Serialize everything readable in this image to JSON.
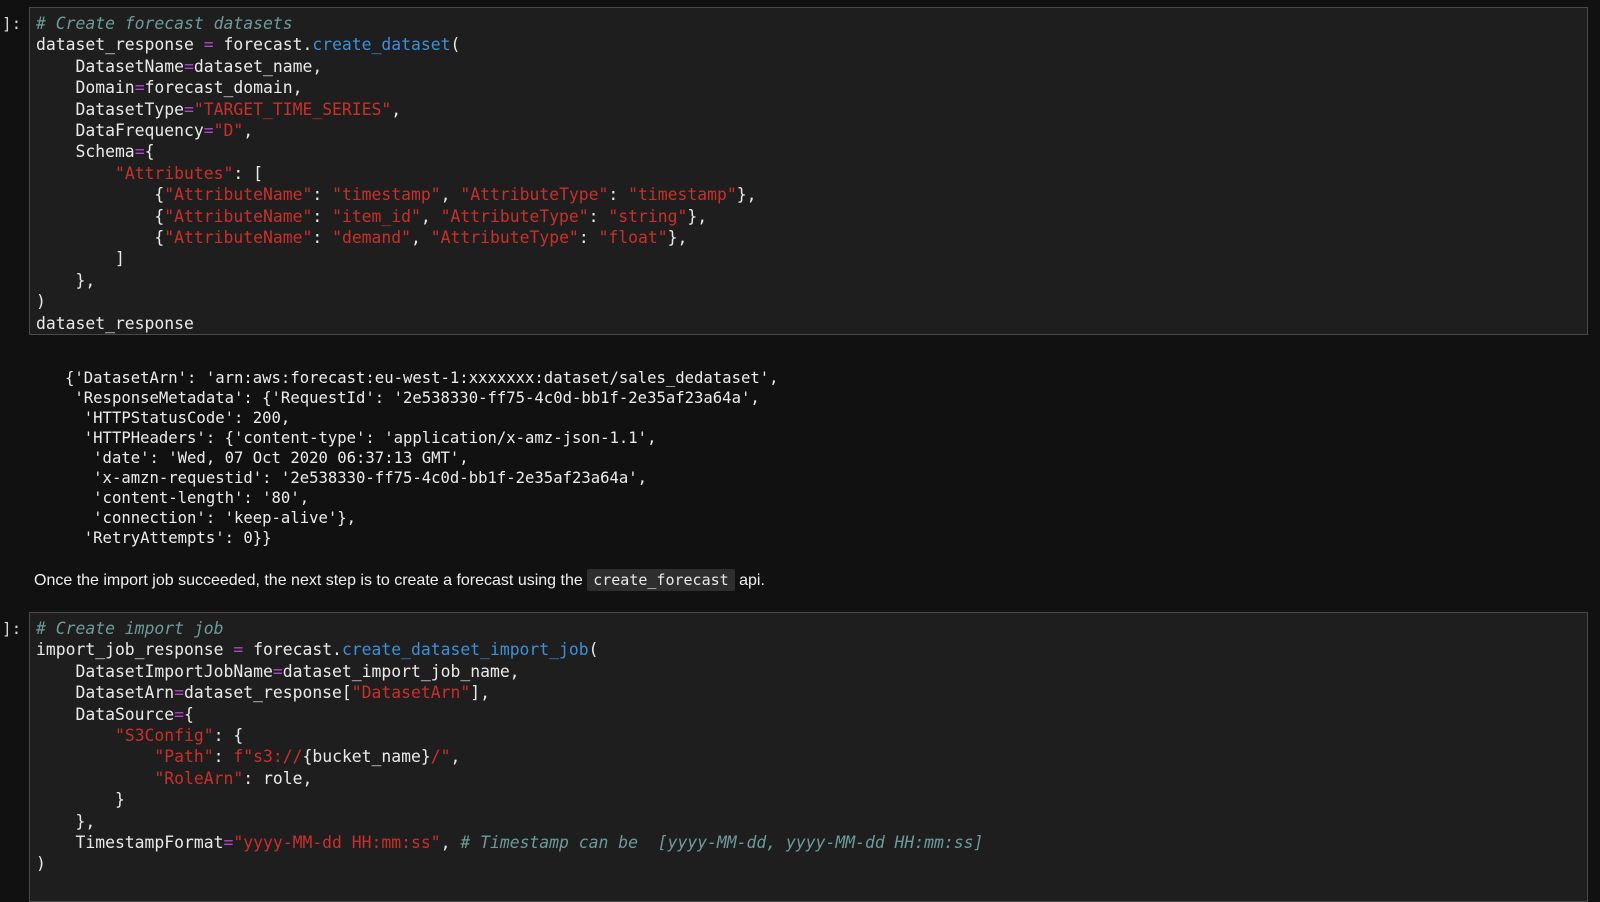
{
  "cells": [
    {
      "prompt": "]:",
      "lines": [
        [
          [
            "cm",
            "# Create forecast datasets"
          ]
        ],
        [
          [
            "t",
            "dataset_response "
          ],
          [
            "op",
            "="
          ],
          [
            "t",
            " forecast."
          ],
          [
            "fn",
            "create_dataset"
          ],
          [
            "t",
            "("
          ]
        ],
        [
          [
            "t",
            "    DatasetName"
          ],
          [
            "op",
            "="
          ],
          [
            "t",
            "dataset_name,"
          ]
        ],
        [
          [
            "t",
            "    Domain"
          ],
          [
            "op",
            "="
          ],
          [
            "t",
            "forecast_domain,"
          ]
        ],
        [
          [
            "t",
            "    DatasetType"
          ],
          [
            "op",
            "="
          ],
          [
            "st",
            "\"TARGET_TIME_SERIES\""
          ],
          [
            "t",
            ","
          ]
        ],
        [
          [
            "t",
            "    DataFrequency"
          ],
          [
            "op",
            "="
          ],
          [
            "st",
            "\"D\""
          ],
          [
            "t",
            ","
          ]
        ],
        [
          [
            "t",
            "    Schema"
          ],
          [
            "op",
            "="
          ],
          [
            "t",
            "{"
          ]
        ],
        [
          [
            "t",
            "        "
          ],
          [
            "st",
            "\"Attributes\""
          ],
          [
            "t",
            ": ["
          ]
        ],
        [
          [
            "t",
            "            {"
          ],
          [
            "st",
            "\"AttributeName\""
          ],
          [
            "t",
            ": "
          ],
          [
            "st",
            "\"timestamp\""
          ],
          [
            "t",
            ", "
          ],
          [
            "st",
            "\"AttributeType\""
          ],
          [
            "t",
            ": "
          ],
          [
            "st",
            "\"timestamp\""
          ],
          [
            "t",
            "},"
          ]
        ],
        [
          [
            "t",
            "            {"
          ],
          [
            "st",
            "\"AttributeName\""
          ],
          [
            "t",
            ": "
          ],
          [
            "st",
            "\"item_id\""
          ],
          [
            "t",
            ", "
          ],
          [
            "st",
            "\"AttributeType\""
          ],
          [
            "t",
            ": "
          ],
          [
            "st",
            "\"string\""
          ],
          [
            "t",
            "},"
          ]
        ],
        [
          [
            "t",
            "            {"
          ],
          [
            "st",
            "\"AttributeName\""
          ],
          [
            "t",
            ": "
          ],
          [
            "st",
            "\"demand\""
          ],
          [
            "t",
            ", "
          ],
          [
            "st",
            "\"AttributeType\""
          ],
          [
            "t",
            ": "
          ],
          [
            "st",
            "\"float\""
          ],
          [
            "t",
            "},"
          ]
        ],
        [
          [
            "t",
            "        ]"
          ]
        ],
        [
          [
            "t",
            "    },"
          ]
        ],
        [
          [
            "t",
            ")"
          ]
        ],
        [
          [
            "t",
            "dataset_response"
          ]
        ]
      ]
    },
    {
      "prompt": "]:",
      "lines": [
        [
          [
            "cm",
            "# Create import job"
          ]
        ],
        [
          [
            "t",
            "import_job_response "
          ],
          [
            "op",
            "="
          ],
          [
            "t",
            " forecast."
          ],
          [
            "fn",
            "create_dataset_import_job"
          ],
          [
            "t",
            "("
          ]
        ],
        [
          [
            "t",
            "    DatasetImportJobName"
          ],
          [
            "op",
            "="
          ],
          [
            "t",
            "dataset_import_job_name,"
          ]
        ],
        [
          [
            "t",
            "    DatasetArn"
          ],
          [
            "op",
            "="
          ],
          [
            "t",
            "dataset_response["
          ],
          [
            "st",
            "\"DatasetArn\""
          ],
          [
            "t",
            "],"
          ]
        ],
        [
          [
            "t",
            "    DataSource"
          ],
          [
            "op",
            "="
          ],
          [
            "t",
            "{"
          ]
        ],
        [
          [
            "t",
            "        "
          ],
          [
            "st",
            "\"S3Config\""
          ],
          [
            "t",
            ": {"
          ]
        ],
        [
          [
            "t",
            "            "
          ],
          [
            "st",
            "\"Path\""
          ],
          [
            "t",
            ": "
          ],
          [
            "st",
            "f\"s3://"
          ],
          [
            "t",
            "{bucket_name}"
          ],
          [
            "st",
            "/\""
          ],
          [
            "t",
            ","
          ]
        ],
        [
          [
            "t",
            "            "
          ],
          [
            "st",
            "\"RoleArn\""
          ],
          [
            "t",
            ": role,"
          ]
        ],
        [
          [
            "t",
            "        }"
          ]
        ],
        [
          [
            "t",
            "    },"
          ]
        ],
        [
          [
            "t",
            "    TimestampFormat"
          ],
          [
            "op",
            "="
          ],
          [
            "st",
            "\"yyyy-MM-dd HH:mm:ss\""
          ],
          [
            "t",
            ", "
          ],
          [
            "cm",
            "# Timestamp can be  [yyyy-MM-dd, yyyy-MM-dd HH:mm:ss]"
          ]
        ],
        [
          [
            "t",
            ")"
          ]
        ]
      ]
    }
  ],
  "output": {
    "lines": [
      "{'DatasetArn': 'arn:aws:forecast:eu-west-1:xxxxxxx:dataset/sales_dedataset',",
      " 'ResponseMetadata': {'RequestId': '2e538330-ff75-4c0d-bb1f-2e35af23a64a',",
      "  'HTTPStatusCode': 200,",
      "  'HTTPHeaders': {'content-type': 'application/x-amz-json-1.1',",
      "   'date': 'Wed, 07 Oct 2020 06:37:13 GMT',",
      "   'x-amzn-requestid': '2e538330-ff75-4c0d-bb1f-2e35af23a64a',",
      "   'content-length': '80',",
      "   'connection': 'keep-alive'},",
      "  'RetryAttempts': 0}}"
    ]
  },
  "markdown": {
    "before": "Once the import job succeeded, the next step is to create a forecast using the ",
    "code": "create_forecast",
    "after": " api."
  }
}
